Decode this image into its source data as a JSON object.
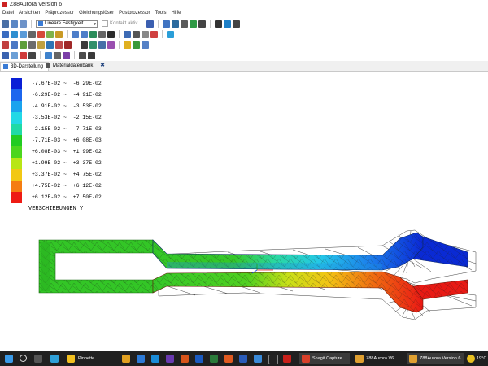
{
  "window": {
    "title": "Z88Aurora Version 6"
  },
  "menu": [
    "Datei",
    "Ansichten",
    "Präprozessor",
    "Gleichungslöser",
    "Postprozessor",
    "Tools",
    "Hilfe"
  ],
  "toolbar": {
    "analysis_type": "Lineare Festigkeit",
    "contact_label": "Kontakt aktiv"
  },
  "tabs": [
    {
      "label": "3D-Darstellung",
      "active": true
    },
    {
      "label": "Materialdatenbank",
      "active": false
    }
  ],
  "legend": {
    "title": "VERSCHIEBUNGEN Y",
    "ranges": [
      {
        "text": "-7.67E-02 ~  -6.29E-02",
        "color": "#0a1fd6"
      },
      {
        "text": "-6.29E-02 ~  -4.91E-02",
        "color": "#1c66ee"
      },
      {
        "text": "-4.91E-02 ~  -3.53E-02",
        "color": "#1aa3ee"
      },
      {
        "text": "-3.53E-02 ~  -2.15E-02",
        "color": "#22d8e6"
      },
      {
        "text": "-2.15E-02 ~  -7.71E-03",
        "color": "#1fdaa6"
      },
      {
        "text": "-7.71E-03 ~  +6.08E-03",
        "color": "#22cc22"
      },
      {
        "text": "+6.08E-03 ~  +1.99E-02",
        "color": "#4cd61e"
      },
      {
        "text": "+1.99E-02 ~  +3.37E-02",
        "color": "#b8e615"
      },
      {
        "text": "+3.37E-02 ~  +4.75E-02",
        "color": "#f2c814"
      },
      {
        "text": "+4.75E-02 ~  +6.12E-02",
        "color": "#f57d12"
      },
      {
        "text": "+6.12E-02 ~  +7.50E-02",
        "color": "#ee1b14"
      }
    ]
  },
  "taskbar": {
    "items": [
      {
        "label": "Pinnette"
      },
      {
        "label": "Snagit Capture"
      },
      {
        "label": "Z88Aurora V6"
      },
      {
        "label": "Z88Aurora Version 6"
      }
    ],
    "temperature": "19°C"
  }
}
